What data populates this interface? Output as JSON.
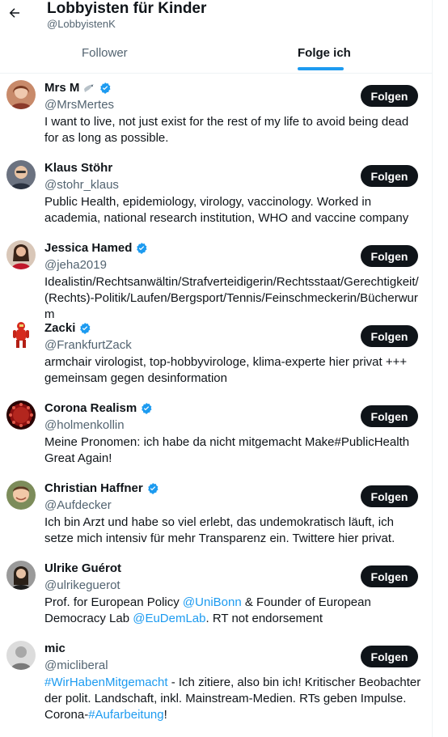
{
  "header": {
    "title": "Lobbyisten für Kinder",
    "handle": "@LobbyistenK",
    "back_icon": "arrow-left-icon"
  },
  "tabs": {
    "followers": "Follower",
    "following": "Folge ich",
    "active": "following",
    "accent": "#1d9bf0"
  },
  "follow_label": "Folgen",
  "users": [
    {
      "name": "Mrs M",
      "name_emoji": "dove-icon",
      "verified": true,
      "handle": "@MrsMertes",
      "bio": "I want to live, not just exist for the rest of my life to avoid being dead for as long as possible."
    },
    {
      "name": "Klaus Stöhr",
      "verified": false,
      "handle": "@stohr_klaus",
      "bio": "Public Health, epidemiology, virology, vaccinology. Worked in academia, national research institution, WHO and vaccine company"
    },
    {
      "name": "Jessica Hamed",
      "verified": true,
      "handle": "@jeha2019",
      "bio": "Idealistin/Rechtsanwältin/Strafverteidigerin/Rechtsstaat/Gerechtigkeit/(Rechts)-Politik/Laufen/Bergsport/Tennis/Feinschmeckerin/Bücherwurm"
    },
    {
      "name": "Zacki",
      "verified": true,
      "handle": "@FrankfurtZack",
      "bio": "armchair virologist, top-hobbyvirologe, klima-experte hier privat +++ gemeinsam gegen desinformation"
    },
    {
      "name": "Corona Realism",
      "verified": true,
      "handle": "@holmenkollin",
      "bio": "Meine Pronomen: ich habe da nicht mitgemacht Make#PublicHealth Great Again!"
    },
    {
      "name": "Christian Haffner",
      "verified": true,
      "handle": "@Aufdecker",
      "bio": "Ich bin Arzt und habe so viel erlebt, das undemokratisch läuft, ich setze mich intensiv für mehr Transparenz ein. Twittere hier privat."
    },
    {
      "name": "Ulrike Guérot",
      "verified": false,
      "handle": "@ulrikeguerot",
      "bio_parts": [
        "Prof. for European Policy ",
        "@UniBonn",
        " & Founder of European Democracy Lab ",
        "@EuDemLab",
        ". RT not endorsement"
      ]
    },
    {
      "name": "mic",
      "verified": false,
      "handle": "@micliberal",
      "bio_parts": [
        "#WirHabenMitgemacht",
        " - Ich zitiere, also bin ich! Kritischer Beobachter der polit. Landschaft, inkl. Mainstream-Medien. RTs geben Impulse. Corona-",
        "#Aufarbeitung",
        "!"
      ]
    }
  ]
}
